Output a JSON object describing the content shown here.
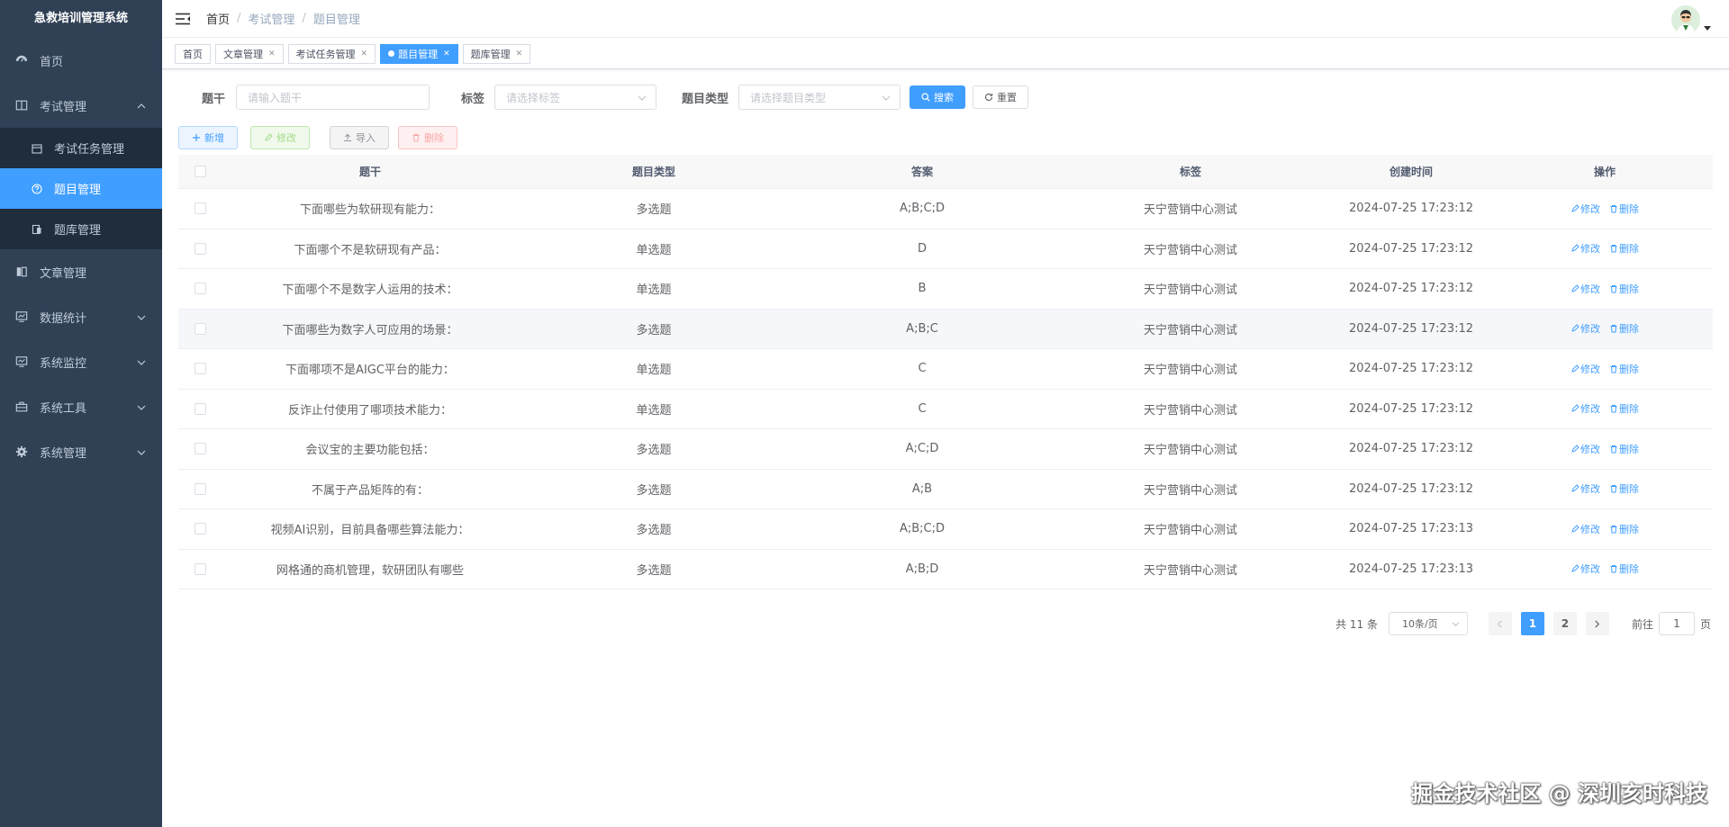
{
  "app": {
    "title": "急救培训管理系统"
  },
  "sidebar": {
    "items": [
      {
        "label": "首页",
        "icon": "dashboard-icon"
      },
      {
        "label": "考试管理",
        "icon": "book-icon",
        "expanded": true,
        "children": [
          {
            "label": "考试任务管理",
            "icon": "calendar-icon"
          },
          {
            "label": "题目管理",
            "icon": "question-icon",
            "active": true
          },
          {
            "label": "题库管理",
            "icon": "database-icon"
          }
        ]
      },
      {
        "label": "文章管理",
        "icon": "article-icon"
      },
      {
        "label": "数据统计",
        "icon": "chart-icon"
      },
      {
        "label": "系统监控",
        "icon": "monitor-icon"
      },
      {
        "label": "系统工具",
        "icon": "toolbox-icon"
      },
      {
        "label": "系统管理",
        "icon": "gear-icon"
      }
    ]
  },
  "breadcrumb": [
    "首页",
    "考试管理",
    "题目管理"
  ],
  "tags": [
    {
      "label": "首页",
      "closable": false
    },
    {
      "label": "文章管理",
      "closable": true
    },
    {
      "label": "考试任务管理",
      "closable": true
    },
    {
      "label": "题目管理",
      "closable": true,
      "active": true
    },
    {
      "label": "题库管理",
      "closable": true
    }
  ],
  "filters": {
    "stem_label": "题干",
    "stem_placeholder": "请输入题干",
    "tag_label": "标签",
    "tag_placeholder": "请选择标签",
    "type_label": "题目类型",
    "type_placeholder": "请选择题目类型",
    "search_button": "搜索",
    "reset_button": "重置"
  },
  "toolbar": {
    "add": "新增",
    "edit": "修改",
    "import": "导入",
    "delete": "删除"
  },
  "table": {
    "columns": [
      "题干",
      "题目类型",
      "答案",
      "标签",
      "创建时间",
      "操作"
    ],
    "op_edit": "修改",
    "op_delete": "删除",
    "rows": [
      {
        "stem": "下面哪些为软研现有能力：",
        "type": "多选题",
        "answer": "A;B;C;D",
        "tag": "天宁营销中心测试",
        "time": "2024-07-25 17:23:12"
      },
      {
        "stem": "下面哪个不是软研现有产品：",
        "type": "单选题",
        "answer": "D",
        "tag": "天宁营销中心测试",
        "time": "2024-07-25 17:23:12"
      },
      {
        "stem": "下面哪个不是数字人运用的技术：",
        "type": "单选题",
        "answer": "B",
        "tag": "天宁营销中心测试",
        "time": "2024-07-25 17:23:12"
      },
      {
        "stem": "下面哪些为数字人可应用的场景：",
        "type": "多选题",
        "answer": "A;B;C",
        "tag": "天宁营销中心测试",
        "time": "2024-07-25 17:23:12"
      },
      {
        "stem": "下面哪项不是AIGC平台的能力：",
        "type": "单选题",
        "answer": "C",
        "tag": "天宁营销中心测试",
        "time": "2024-07-25 17:23:12"
      },
      {
        "stem": "反诈止付使用了哪项技术能力：",
        "type": "单选题",
        "answer": "C",
        "tag": "天宁营销中心测试",
        "time": "2024-07-25 17:23:12"
      },
      {
        "stem": "会议宝的主要功能包括：",
        "type": "多选题",
        "answer": "A;C;D",
        "tag": "天宁营销中心测试",
        "time": "2024-07-25 17:23:12"
      },
      {
        "stem": "不属于产品矩阵的有：",
        "type": "多选题",
        "answer": "A;B",
        "tag": "天宁营销中心测试",
        "time": "2024-07-25 17:23:12"
      },
      {
        "stem": "视频AI识别，目前具备哪些算法能力：",
        "type": "多选题",
        "answer": "A;B;C;D",
        "tag": "天宁营销中心测试",
        "time": "2024-07-25 17:23:13"
      },
      {
        "stem": "网格通的商机管理，软研团队有哪些",
        "type": "多选题",
        "answer": "A;B;D",
        "tag": "天宁营销中心测试",
        "time": "2024-07-25 17:23:13"
      }
    ]
  },
  "pagination": {
    "total_text": "共 11 条",
    "page_size": "10条/页",
    "pages": [
      "1",
      "2"
    ],
    "current": "1",
    "goto_label": "前往",
    "goto_value": "1",
    "page_suffix": "页"
  },
  "watermark": "掘金技术社区 @ 深圳亥时科技",
  "colors": {
    "sidebar_bg": "#304156",
    "active": "#409eff"
  }
}
